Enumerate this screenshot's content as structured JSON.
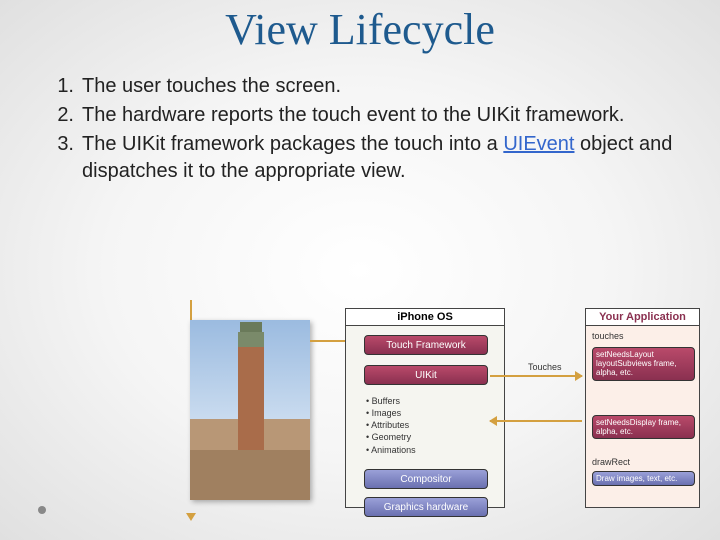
{
  "title": "View Lifecycle",
  "items": [
    {
      "num": "1.",
      "text": "The user touches the screen."
    },
    {
      "num": "2.",
      "text": "The hardware reports the touch event to the UIKit framework."
    },
    {
      "num": "3.",
      "prefix": "The UIKit framework packages the touch into a ",
      "link": "UIEvent",
      "suffix": " object and dispatches it to the appropriate view."
    }
  ],
  "diagram": {
    "os_header": "iPhone OS",
    "os_boxes": {
      "touch": "Touch Framework",
      "uikit": "UIKit",
      "compositor": "Compositor",
      "gfx": "Graphics hardware"
    },
    "os_bullets": [
      "Buffers",
      "Images",
      "Attributes",
      "Geometry",
      "Animations"
    ],
    "app_header": "Your Application",
    "app_labels": {
      "touches": "touches",
      "drawrect": "drawRect"
    },
    "app_boxes": {
      "b1": "setNeedsLayout layoutSubviews frame, alpha, etc.",
      "b2": "setNeedsDisplay frame, alpha, etc.",
      "b3": "Draw images, text, etc."
    },
    "arrow_label_touches": "Touches"
  }
}
